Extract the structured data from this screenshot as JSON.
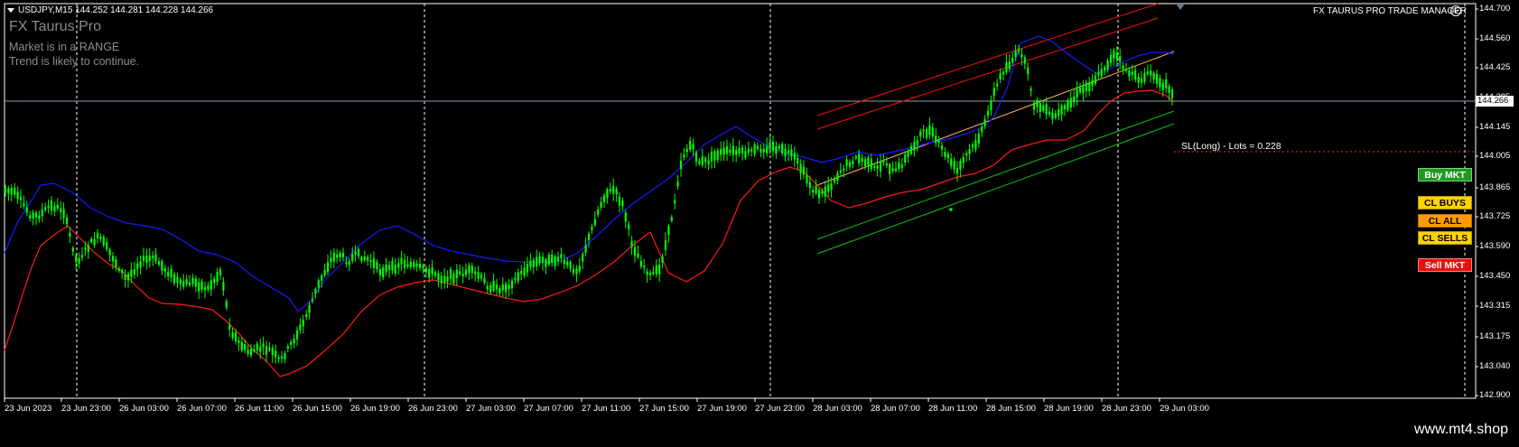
{
  "header": {
    "symbol_line": "USDJPY,M15  144.252 144.281 144.228 144.266",
    "indicator_name": "FX Taurus Pro",
    "status_line_1": "Market is in a RANGE",
    "status_line_2": "Trend is likely to continue.",
    "trade_manager": "FX TAURUS PRO TRADE MANAGER"
  },
  "sl_label": "SL(Long) - Lots = 0.228",
  "buttons": {
    "buy_mkt": "Buy MKT",
    "cl_buys": "CL BUYS",
    "cl_all": "CL ALL",
    "cl_sells": "CL SELLS",
    "sell_mkt": "Sell MKT"
  },
  "price_axis": {
    "ticks": [
      "144.700",
      "144.560",
      "144.425",
      "144.285",
      "144.145",
      "144.005",
      "143.865",
      "143.725",
      "143.590",
      "143.450",
      "143.315",
      "143.175",
      "143.040",
      "142.900"
    ],
    "current_price": "144.266"
  },
  "time_axis": {
    "ticks": [
      "23 Jun 2023",
      "23 Jun 23:00",
      "26 Jun 03:00",
      "26 Jun 07:00",
      "26 Jun 11:00",
      "26 Jun 15:00",
      "26 Jun 19:00",
      "26 Jun 23:00",
      "27 Jun 03:00",
      "27 Jun 07:00",
      "27 Jun 11:00",
      "27 Jun 15:00",
      "27 Jun 19:00",
      "27 Jun 23:00",
      "28 Jun 03:00",
      "28 Jun 07:00",
      "28 Jun 11:00",
      "28 Jun 15:00",
      "28 Jun 19:00",
      "28 Jun 23:00",
      "29 Jun 03:00"
    ]
  },
  "footer": {
    "site": "www.mt4.shop"
  },
  "colors": {
    "background": "#000000",
    "candles": "#00ff00",
    "ma_slow": "#1a1aff",
    "ma_fast": "#ff1a1a",
    "channel_upper": "#ff0000",
    "channel_lower": "#00c000",
    "buy": "#1e9b1e",
    "cl_buys": "#ffd200",
    "cl_all": "#ff9b00",
    "cl_sells": "#ffd200",
    "sell": "#e81010"
  }
}
